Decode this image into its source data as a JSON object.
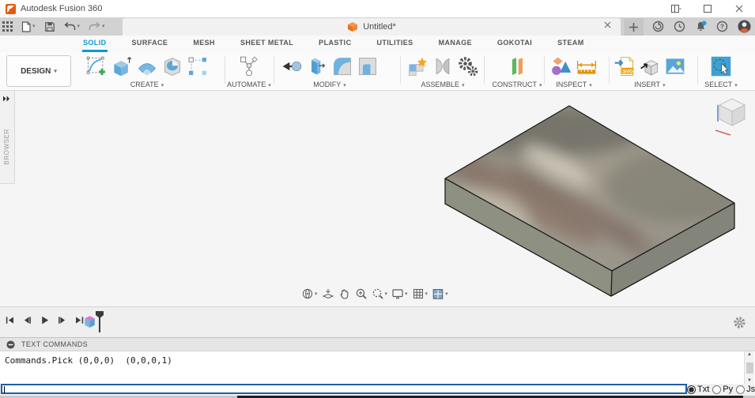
{
  "window": {
    "title": "Autodesk Fusion 360"
  },
  "document_tab": {
    "title": "Untitled*"
  },
  "ribbon": {
    "active_tab": "SOLID",
    "tabs": [
      "SOLID",
      "SURFACE",
      "MESH",
      "SHEET METAL",
      "PLASTIC",
      "UTILITIES",
      "MANAGE",
      "GOKOTAI",
      "STEAM"
    ]
  },
  "toolbar": {
    "design_label": "DESIGN",
    "groups": [
      "CREATE",
      "AUTOMATE",
      "MODIFY",
      "ASSEMBLE",
      "CONSTRUCT",
      "INSPECT",
      "INSERT",
      "SELECT"
    ]
  },
  "icons": {
    "svg_badge": "SVG",
    "help_glyph": "?"
  },
  "browser_panel": {
    "label": "BROWSER"
  },
  "text_commands": {
    "header": "TEXT COMMANDS",
    "output_line": "Commands.Pick (0,0,0)  (0,0,0,1)",
    "mode_options": [
      "Txt",
      "Py",
      "Js"
    ],
    "selected_mode": "Txt"
  },
  "colors": {
    "accent_blue": "#0a99d5",
    "fusion_orange": "#f2690d",
    "badge_blue": "#1f9bde"
  }
}
